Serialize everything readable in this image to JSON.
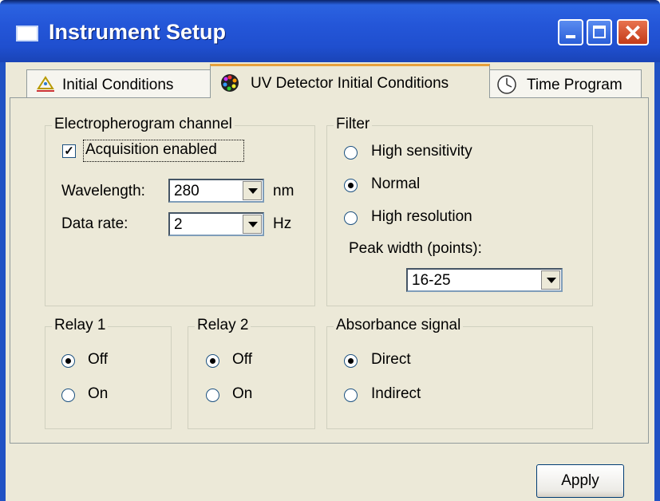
{
  "window": {
    "title": "Instrument Setup",
    "close_glyph": "✕"
  },
  "tabs": [
    {
      "label": "Initial Conditions",
      "icon": "initial-conditions-icon",
      "active": false
    },
    {
      "label": "UV Detector Initial Conditions",
      "icon": "uv-detector-icon",
      "active": true
    },
    {
      "label": "Time Program",
      "icon": "clock-icon",
      "active": false
    }
  ],
  "electropherogram": {
    "title": "Electropherogram channel",
    "acquisition_label": "Acquisition enabled",
    "acquisition_checked": true,
    "check_glyph": "✓",
    "wavelength_label": "Wavelength:",
    "wavelength_value": "280",
    "wavelength_unit": "nm",
    "datarate_label": "Data rate:",
    "datarate_value": "2",
    "datarate_unit": "Hz"
  },
  "filter": {
    "title": "Filter",
    "options": [
      "High sensitivity",
      "Normal",
      "High resolution"
    ],
    "selected": "Normal",
    "peak_width_label": "Peak width (points):",
    "peak_width_value": "16-25"
  },
  "relay1": {
    "title": "Relay 1",
    "options": [
      "Off",
      "On"
    ],
    "selected": "Off"
  },
  "relay2": {
    "title": "Relay 2",
    "options": [
      "Off",
      "On"
    ],
    "selected": "Off"
  },
  "absorbance": {
    "title": "Absorbance signal",
    "options": [
      "Direct",
      "Indirect"
    ],
    "selected": "Direct"
  },
  "apply_label": "Apply",
  "colors": {
    "titlebar": "#2456d8",
    "face": "#ece9d8",
    "tab_highlight": "#e6a03c"
  }
}
